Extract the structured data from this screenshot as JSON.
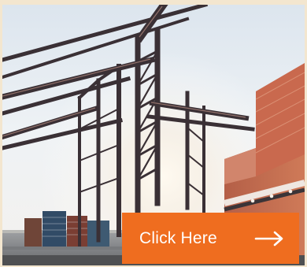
{
  "hero": {
    "button": {
      "label": "Click Here",
      "icon": "arrow-right-icon",
      "background_color": "#ef6d1f",
      "text_color": "#ffffff"
    },
    "colors": {
      "crane": "#3a3035",
      "ship_hull": "#c9694e"
    }
  }
}
